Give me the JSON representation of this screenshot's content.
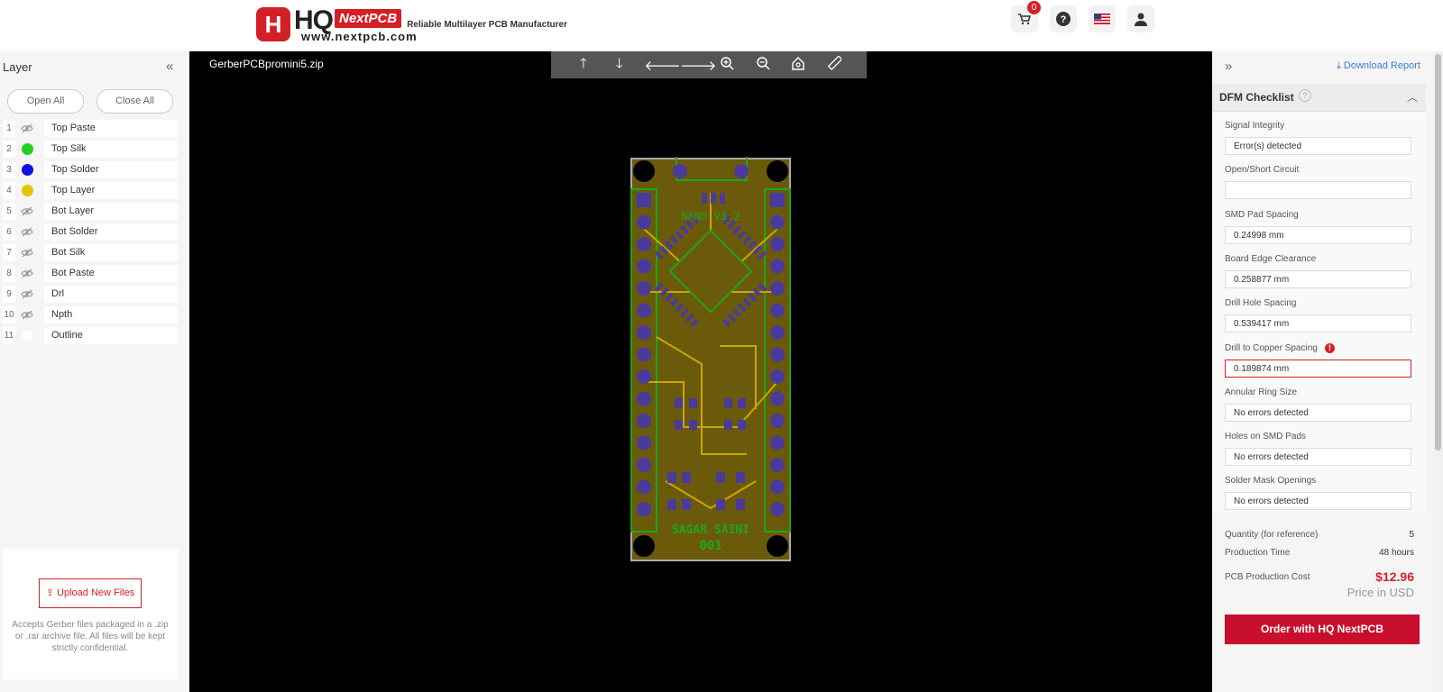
{
  "header": {
    "logo_mark": "H",
    "logo_hq": "HQ",
    "logo_badge": "NextPCB",
    "tagline": "Reliable Multilayer PCB Manufacturer",
    "url": "www.nextpcb.com",
    "cart_count": "0",
    "icons": [
      "cart-icon",
      "help-icon",
      "flag-us-icon",
      "user-icon"
    ]
  },
  "layers_panel": {
    "title": "Layer",
    "open_all": "Open All",
    "close_all": "Close All",
    "layers": [
      {
        "num": "1",
        "name": "Top Paste",
        "visible": false,
        "color": ""
      },
      {
        "num": "2",
        "name": "Top Silk",
        "visible": true,
        "color": "#22d022"
      },
      {
        "num": "3",
        "name": "Top Solder",
        "visible": true,
        "color": "#1010e0"
      },
      {
        "num": "4",
        "name": "Top Layer",
        "visible": true,
        "color": "#e0c800"
      },
      {
        "num": "5",
        "name": "Bot Layer",
        "visible": false,
        "color": ""
      },
      {
        "num": "6",
        "name": "Bot Solder",
        "visible": false,
        "color": ""
      },
      {
        "num": "7",
        "name": "Bot Silk",
        "visible": false,
        "color": ""
      },
      {
        "num": "8",
        "name": "Bot Paste",
        "visible": false,
        "color": ""
      },
      {
        "num": "9",
        "name": "Drl",
        "visible": false,
        "color": ""
      },
      {
        "num": "10",
        "name": "Npth",
        "visible": false,
        "color": ""
      },
      {
        "num": "11",
        "name": "Outline",
        "visible": true,
        "color": "#ffffff"
      }
    ],
    "upload_label": "Upload New Files",
    "upload_note": "Accepts Gerber files packaged in a .zip or .rar archive file. All files will be kept strictly confidential."
  },
  "viewer": {
    "filename": "GerberPCBpromini5.zip",
    "tools": [
      "arrow-up-icon",
      "arrow-down-icon",
      "arrow-left-icon",
      "arrow-right-icon",
      "zoom-in-icon",
      "zoom-out-icon",
      "home-icon",
      "ruler-icon"
    ],
    "board_text_1": "SAGAR SAINI",
    "board_text_2": "001",
    "board_text_3": "NANO V3.2"
  },
  "dfm": {
    "download": "Download Report",
    "title": "DFM Checklist",
    "checks": [
      {
        "label": "Signal Integrity",
        "value": "Error(s) detected",
        "error": false
      },
      {
        "label": "Open/Short Circuit",
        "value": "",
        "error": false
      },
      {
        "label": "SMD Pad Spacing",
        "value": "0.24998 mm",
        "error": false
      },
      {
        "label": "Board Edge Clearance",
        "value": "0.258877 mm",
        "error": false
      },
      {
        "label": "Drill Hole Spacing",
        "value": "0.539417 mm",
        "error": false
      },
      {
        "label": "Drill to Copper Spacing",
        "value": "0.189874 mm",
        "error": true
      },
      {
        "label": "Annular Ring Size",
        "value": "No errors detected",
        "error": false
      },
      {
        "label": "Holes on SMD Pads",
        "value": "No errors detected",
        "error": false
      },
      {
        "label": "Solder Mask Openings",
        "value": "No errors detected",
        "error": false
      }
    ]
  },
  "summary": {
    "qty_label": "Quantity (for reference)",
    "qty": "5",
    "time_label": "Production Time",
    "time": "48 hours",
    "cost_label": "PCB Production Cost",
    "cost": "$12.96",
    "currency": "Price in USD",
    "order": "Order with HQ NextPCB"
  }
}
